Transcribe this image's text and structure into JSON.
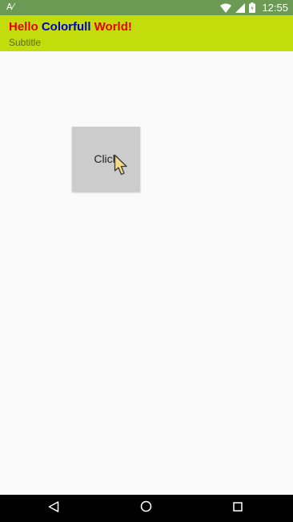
{
  "status_bar": {
    "notification": "A⁄",
    "time": "12:55",
    "icons": [
      "wifi-icon",
      "signal-icon",
      "battery-icon"
    ]
  },
  "app_bar": {
    "title_parts": [
      {
        "text": "Hello ",
        "color": "#e60000"
      },
      {
        "text": "Colorfull ",
        "color": "#0000c8"
      },
      {
        "text": "World!",
        "color": "#e60000"
      }
    ],
    "subtitle": "Subtitle",
    "background": "#c3dc0c"
  },
  "main": {
    "button_label": "Click"
  },
  "nav_bar": {
    "icons": [
      "back-icon",
      "home-icon",
      "recents-icon"
    ]
  }
}
